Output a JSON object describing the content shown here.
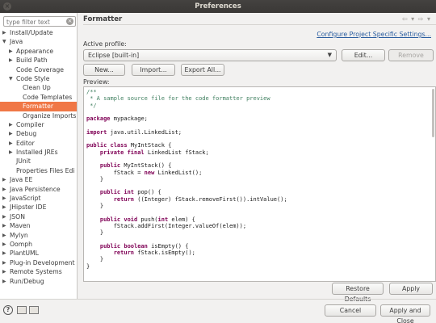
{
  "window": {
    "title": "Preferences"
  },
  "filter": {
    "placeholder": "type filter text"
  },
  "tree": [
    {
      "label": "Install/Update",
      "depth": 0,
      "arrow": "right",
      "selected": false
    },
    {
      "label": "Java",
      "depth": 0,
      "arrow": "down",
      "selected": false
    },
    {
      "label": "Appearance",
      "depth": 1,
      "arrow": "right",
      "selected": false
    },
    {
      "label": "Build Path",
      "depth": 1,
      "arrow": "right",
      "selected": false
    },
    {
      "label": "Code Coverage",
      "depth": 1,
      "arrow": "none",
      "selected": false
    },
    {
      "label": "Code Style",
      "depth": 1,
      "arrow": "down",
      "selected": false
    },
    {
      "label": "Clean Up",
      "depth": 2,
      "arrow": "none",
      "selected": false
    },
    {
      "label": "Code Templates",
      "depth": 2,
      "arrow": "none",
      "selected": false
    },
    {
      "label": "Formatter",
      "depth": 2,
      "arrow": "none",
      "selected": true
    },
    {
      "label": "Organize Imports",
      "depth": 2,
      "arrow": "none",
      "selected": false
    },
    {
      "label": "Compiler",
      "depth": 1,
      "arrow": "right",
      "selected": false
    },
    {
      "label": "Debug",
      "depth": 1,
      "arrow": "right",
      "selected": false
    },
    {
      "label": "Editor",
      "depth": 1,
      "arrow": "right",
      "selected": false
    },
    {
      "label": "Installed JREs",
      "depth": 1,
      "arrow": "right",
      "selected": false
    },
    {
      "label": "JUnit",
      "depth": 1,
      "arrow": "none",
      "selected": false
    },
    {
      "label": "Properties Files Edi",
      "depth": 1,
      "arrow": "none",
      "selected": false
    },
    {
      "label": "Java EE",
      "depth": 0,
      "arrow": "right",
      "selected": false
    },
    {
      "label": "Java Persistence",
      "depth": 0,
      "arrow": "right",
      "selected": false
    },
    {
      "label": "JavaScript",
      "depth": 0,
      "arrow": "right",
      "selected": false
    },
    {
      "label": "JHipster IDE",
      "depth": 0,
      "arrow": "right",
      "selected": false
    },
    {
      "label": "JSON",
      "depth": 0,
      "arrow": "right",
      "selected": false
    },
    {
      "label": "Maven",
      "depth": 0,
      "arrow": "right",
      "selected": false
    },
    {
      "label": "Mylyn",
      "depth": 0,
      "arrow": "right",
      "selected": false
    },
    {
      "label": "Oomph",
      "depth": 0,
      "arrow": "right",
      "selected": false
    },
    {
      "label": "PlantUML",
      "depth": 0,
      "arrow": "right",
      "selected": false
    },
    {
      "label": "Plug-in Development",
      "depth": 0,
      "arrow": "right",
      "selected": false
    },
    {
      "label": "Remote Systems",
      "depth": 0,
      "arrow": "right",
      "selected": false
    },
    {
      "label": "Run/Debug",
      "depth": 0,
      "arrow": "right",
      "selected": false
    }
  ],
  "page": {
    "heading": "Formatter",
    "config_link": "Configure Project Specific Settings...",
    "active_profile_label": "Active profile:",
    "profile_value": "Eclipse [built-in]",
    "edit_label": "Edit...",
    "remove_label": "Remove",
    "new_label": "New...",
    "import_label": "Import...",
    "export_label": "Export All...",
    "preview_label": "Preview:"
  },
  "code_lines": [
    [
      [
        "c",
        "/**"
      ]
    ],
    [
      [
        "c",
        " * A sample source file for the code formatter preview"
      ]
    ],
    [
      [
        "c",
        " */"
      ]
    ],
    [
      [
        "",
        ""
      ]
    ],
    [
      [
        "k",
        "package"
      ],
      [
        "",
        " mypackage;"
      ]
    ],
    [
      [
        "",
        ""
      ]
    ],
    [
      [
        "k",
        "import"
      ],
      [
        "",
        " java.util.LinkedList;"
      ]
    ],
    [
      [
        "",
        ""
      ]
    ],
    [
      [
        "k",
        "public class"
      ],
      [
        "",
        " MyIntStack {"
      ]
    ],
    [
      [
        "",
        "    "
      ],
      [
        "k",
        "private final"
      ],
      [
        "",
        " LinkedList fStack;"
      ]
    ],
    [
      [
        "",
        ""
      ]
    ],
    [
      [
        "",
        "    "
      ],
      [
        "k",
        "public"
      ],
      [
        "",
        " MyIntStack() {"
      ]
    ],
    [
      [
        "",
        "        fStack = "
      ],
      [
        "k",
        "new"
      ],
      [
        "",
        " LinkedList();"
      ]
    ],
    [
      [
        "",
        "    }"
      ]
    ],
    [
      [
        "",
        ""
      ]
    ],
    [
      [
        "",
        "    "
      ],
      [
        "k",
        "public int"
      ],
      [
        "",
        " pop() {"
      ]
    ],
    [
      [
        "",
        "        "
      ],
      [
        "k",
        "return"
      ],
      [
        "",
        " ((Integer) fStack.removeFirst()).intValue();"
      ]
    ],
    [
      [
        "",
        "    }"
      ]
    ],
    [
      [
        "",
        ""
      ]
    ],
    [
      [
        "",
        "    "
      ],
      [
        "k",
        "public void"
      ],
      [
        "",
        " push("
      ],
      [
        "k",
        "int"
      ],
      [
        "",
        " elem) {"
      ]
    ],
    [
      [
        "",
        "        fStack.addFirst(Integer.valueOf(elem));"
      ]
    ],
    [
      [
        "",
        "    }"
      ]
    ],
    [
      [
        "",
        ""
      ]
    ],
    [
      [
        "",
        "    "
      ],
      [
        "k",
        "public boolean"
      ],
      [
        "",
        " isEmpty() {"
      ]
    ],
    [
      [
        "",
        "        "
      ],
      [
        "k",
        "return"
      ],
      [
        "",
        " fStack.isEmpty();"
      ]
    ],
    [
      [
        "",
        "    }"
      ]
    ],
    [
      [
        "",
        "}"
      ]
    ]
  ],
  "buttons": {
    "restore_defaults": "Restore Defaults",
    "apply": "Apply",
    "cancel": "Cancel",
    "apply_and_close": "Apply and Close"
  },
  "icons": {
    "close": "×",
    "help": "?",
    "clear_filter": "×",
    "nav": "⇦ ▾ ⇨ ▾"
  },
  "colors": {
    "selection": "#f07746",
    "keyword": "#7f0055",
    "comment": "#3f7f5f",
    "link": "#2a5d9f"
  }
}
